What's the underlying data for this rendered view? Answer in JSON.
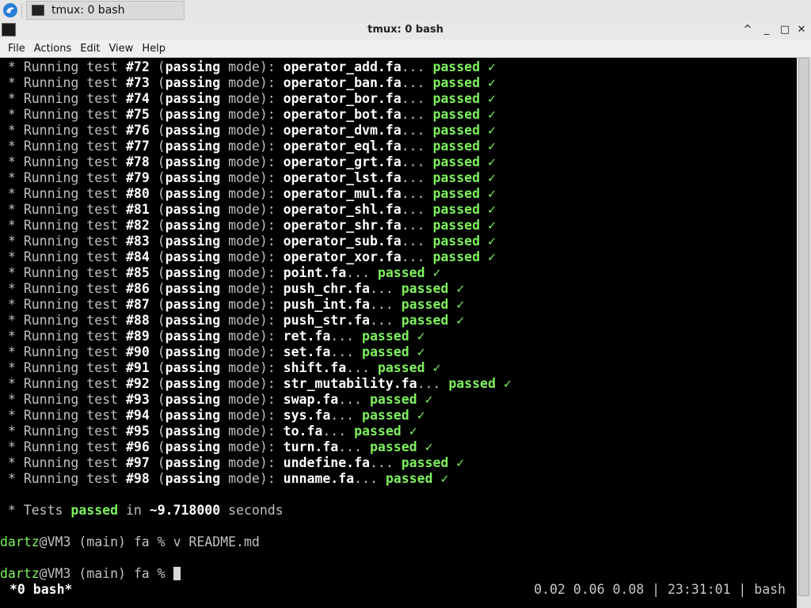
{
  "taskbar": {
    "task_label": "tmux: 0 bash"
  },
  "window": {
    "title": "tmux: 0 bash",
    "buttons": [
      "^",
      "_",
      "□",
      "✕"
    ]
  },
  "menu": [
    "File",
    "Actions",
    "Edit",
    "View",
    "Help"
  ],
  "tests": [
    {
      "num": "#72",
      "file": "operator_add.fa"
    },
    {
      "num": "#73",
      "file": "operator_ban.fa"
    },
    {
      "num": "#74",
      "file": "operator_bor.fa"
    },
    {
      "num": "#75",
      "file": "operator_bot.fa"
    },
    {
      "num": "#76",
      "file": "operator_dvm.fa"
    },
    {
      "num": "#77",
      "file": "operator_eql.fa"
    },
    {
      "num": "#78",
      "file": "operator_grt.fa"
    },
    {
      "num": "#79",
      "file": "operator_lst.fa"
    },
    {
      "num": "#80",
      "file": "operator_mul.fa"
    },
    {
      "num": "#81",
      "file": "operator_shl.fa"
    },
    {
      "num": "#82",
      "file": "operator_shr.fa"
    },
    {
      "num": "#83",
      "file": "operator_sub.fa"
    },
    {
      "num": "#84",
      "file": "operator_xor.fa"
    },
    {
      "num": "#85",
      "file": "point.fa"
    },
    {
      "num": "#86",
      "file": "push_chr.fa"
    },
    {
      "num": "#87",
      "file": "push_int.fa"
    },
    {
      "num": "#88",
      "file": "push_str.fa"
    },
    {
      "num": "#89",
      "file": "ret.fa"
    },
    {
      "num": "#90",
      "file": "set.fa"
    },
    {
      "num": "#91",
      "file": "shift.fa"
    },
    {
      "num": "#92",
      "file": "str_mutability.fa"
    },
    {
      "num": "#93",
      "file": "swap.fa"
    },
    {
      "num": "#94",
      "file": "sys.fa"
    },
    {
      "num": "#95",
      "file": "to.fa"
    },
    {
      "num": "#96",
      "file": "turn.fa"
    },
    {
      "num": "#97",
      "file": "undefine.fa"
    },
    {
      "num": "#98",
      "file": "unname.fa"
    }
  ],
  "line_text": {
    "bullet": " * ",
    "running": "Running test ",
    "mode_open": " (",
    "mode_word": "passing",
    "mode_rest": " mode): ",
    "ellipsis": "... ",
    "passed": "passed",
    "check": " ✓"
  },
  "summary": {
    "prefix": " * Tests ",
    "passed": "passed",
    "mid": " in ",
    "time": "~9.718000",
    "suffix": " seconds"
  },
  "prompt": {
    "user": "dartz",
    "host_path": "@VM3 (main) fa % ",
    "command": "v README.md"
  },
  "status": {
    "left": "*0 bash*",
    "right": "0.02 0.06 0.08 | 23:31:01 | bash"
  },
  "colors": {
    "green": "#7cf25a",
    "terminal_bg": "#000000"
  },
  "icons": [
    "start-menu-icon",
    "terminal-icon",
    "maximize-icon",
    "minimize-icon",
    "restore-icon",
    "close-icon"
  ]
}
